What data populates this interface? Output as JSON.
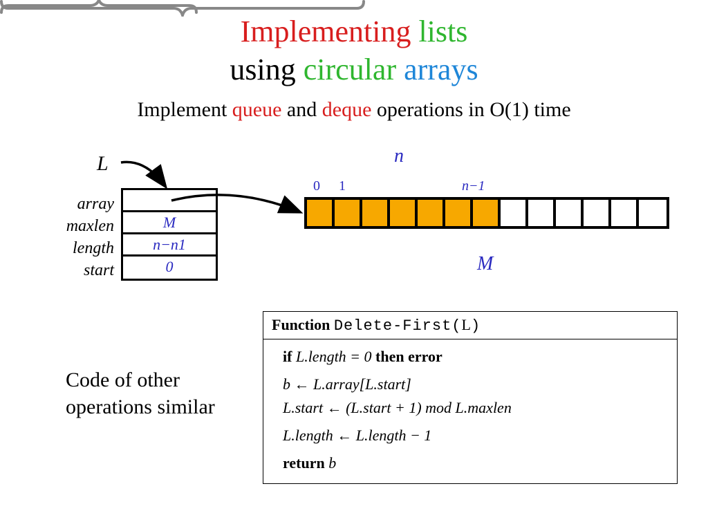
{
  "title": {
    "w1": "Implementing",
    "w2": "lists",
    "w3": "using",
    "w4": "circular",
    "w5": "arrays"
  },
  "subtitle": {
    "t1": "Implement ",
    "t2": "queue",
    "t3": " and ",
    "t4": "deque",
    "t5": " operations in O(1) time"
  },
  "L": "L",
  "struct": {
    "labels": {
      "array": "array",
      "maxlen": "maxlen",
      "length": "length",
      "start": "start"
    },
    "values": {
      "array": "",
      "maxlen": "M",
      "length": "n−n1",
      "start": "0"
    }
  },
  "n_label": "n",
  "M_label": "M",
  "indices": {
    "zero": "0",
    "one": "1",
    "nminus1": "n−1"
  },
  "array_cells": {
    "total": 13,
    "filled": 7
  },
  "code": {
    "kw_function": "Function",
    "fn_name": "Delete-First(",
    "fn_arg": "L",
    "fn_close": ")",
    "l1_if": "if",
    "l1_cond": " L.length = 0 ",
    "l1_then": "then error",
    "l2": "b ← L.array[L.start]",
    "l3": "L.start ← (L.start + 1) mod L.maxlen",
    "l4": "L.length ← L.length − 1",
    "l5_kw": "return",
    "l5_v": " b"
  },
  "note": {
    "l1": "Code of other",
    "l2": "operations similar"
  }
}
